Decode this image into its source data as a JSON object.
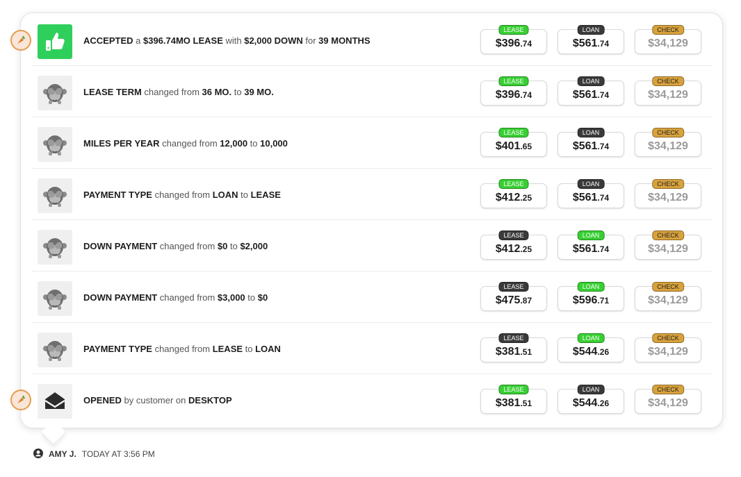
{
  "rows": [
    {
      "parts": [
        [
          "b",
          "ACCEPTED"
        ],
        [
          "t",
          " a "
        ],
        [
          "b",
          "$396.74MO LEASE"
        ],
        [
          "t",
          " with "
        ],
        [
          "b",
          "$2,000 DOWN"
        ],
        [
          "t",
          " for "
        ],
        [
          "b",
          "39 MONTHS"
        ]
      ],
      "icon": "thumbs-up-icon",
      "lease": {
        "tag": "LEASE",
        "dollars": "$396",
        "cents": ".74",
        "tag_style": "green"
      },
      "loan": {
        "tag": "LOAN",
        "dollars": "$561",
        "cents": ".74",
        "tag_style": "dark"
      },
      "check": {
        "tag": "CHECK",
        "value": "$34,129"
      }
    },
    {
      "parts": [
        [
          "b",
          "LEASE TERM"
        ],
        [
          "t",
          " changed from "
        ],
        [
          "b",
          "36 MO."
        ],
        [
          "t",
          " to "
        ],
        [
          "b",
          "39 MO."
        ]
      ],
      "icon": "see-no-evil-monkey-icon",
      "lease": {
        "tag": "LEASE",
        "dollars": "$396",
        "cents": ".74",
        "tag_style": "green"
      },
      "loan": {
        "tag": "LOAN",
        "dollars": "$561",
        "cents": ".74",
        "tag_style": "dark"
      },
      "check": {
        "tag": "CHECK",
        "value": "$34,129"
      }
    },
    {
      "parts": [
        [
          "b",
          "MILES PER YEAR"
        ],
        [
          "t",
          " changed from "
        ],
        [
          "b",
          "12,000"
        ],
        [
          "t",
          " to "
        ],
        [
          "b",
          "10,000"
        ]
      ],
      "icon": "see-no-evil-monkey-icon",
      "lease": {
        "tag": "LEASE",
        "dollars": "$401",
        "cents": ".65",
        "tag_style": "green"
      },
      "loan": {
        "tag": "LOAN",
        "dollars": "$561",
        "cents": ".74",
        "tag_style": "dark"
      },
      "check": {
        "tag": "CHECK",
        "value": "$34,129"
      }
    },
    {
      "parts": [
        [
          "b",
          "PAYMENT TYPE"
        ],
        [
          "t",
          " changed from "
        ],
        [
          "b",
          "LOAN"
        ],
        [
          "t",
          " to "
        ],
        [
          "b",
          "LEASE"
        ]
      ],
      "icon": "see-no-evil-monkey-icon",
      "lease": {
        "tag": "LEASE",
        "dollars": "$412",
        "cents": ".25",
        "tag_style": "green"
      },
      "loan": {
        "tag": "LOAN",
        "dollars": "$561",
        "cents": ".74",
        "tag_style": "dark"
      },
      "check": {
        "tag": "CHECK",
        "value": "$34,129"
      }
    },
    {
      "parts": [
        [
          "b",
          "DOWN PAYMENT"
        ],
        [
          "t",
          " changed from "
        ],
        [
          "b",
          "$0"
        ],
        [
          "t",
          " to "
        ],
        [
          "b",
          "$2,000"
        ]
      ],
      "icon": "see-no-evil-monkey-icon",
      "lease": {
        "tag": "LEASE",
        "dollars": "$412",
        "cents": ".25",
        "tag_style": "dark"
      },
      "loan": {
        "tag": "LOAN",
        "dollars": "$561",
        "cents": ".74",
        "tag_style": "green"
      },
      "check": {
        "tag": "CHECK",
        "value": "$34,129"
      }
    },
    {
      "parts": [
        [
          "b",
          "DOWN PAYMENT"
        ],
        [
          "t",
          " changed from "
        ],
        [
          "b",
          "$3,000"
        ],
        [
          "t",
          " to "
        ],
        [
          "b",
          "$0"
        ]
      ],
      "icon": "see-no-evil-monkey-icon",
      "lease": {
        "tag": "LEASE",
        "dollars": "$475",
        "cents": ".87",
        "tag_style": "dark"
      },
      "loan": {
        "tag": "LOAN",
        "dollars": "$596",
        "cents": ".71",
        "tag_style": "green"
      },
      "check": {
        "tag": "CHECK",
        "value": "$34,129"
      }
    },
    {
      "parts": [
        [
          "b",
          "PAYMENT TYPE"
        ],
        [
          "t",
          " changed from "
        ],
        [
          "b",
          "LEASE"
        ],
        [
          "t",
          " to "
        ],
        [
          "b",
          "LOAN"
        ]
      ],
      "icon": "see-no-evil-monkey-icon",
      "lease": {
        "tag": "LEASE",
        "dollars": "$381",
        "cents": ".51",
        "tag_style": "dark"
      },
      "loan": {
        "tag": "LOAN",
        "dollars": "$544",
        "cents": ".26",
        "tag_style": "green"
      },
      "check": {
        "tag": "CHECK",
        "value": "$34,129"
      }
    },
    {
      "parts": [
        [
          "b",
          "OPENED"
        ],
        [
          "t",
          " by customer on "
        ],
        [
          "b",
          "DESKTOP"
        ]
      ],
      "icon": "envelope-open-icon",
      "lease": {
        "tag": "LEASE",
        "dollars": "$381",
        "cents": ".51",
        "tag_style": "green"
      },
      "loan": {
        "tag": "LOAN",
        "dollars": "$544",
        "cents": ".26",
        "tag_style": "dark"
      },
      "check": {
        "tag": "CHECK",
        "value": "$34,129"
      }
    }
  ],
  "side_badges": [
    {
      "row": 0,
      "icon": "carrot-icon"
    },
    {
      "row": 7,
      "icon": "carrot-icon"
    }
  ],
  "footer": {
    "name": "AMY J.",
    "time": "TODAY AT 3:56 PM",
    "icon": "user-circle-icon"
  },
  "colors": {
    "green": "#38cf33",
    "dark": "#3a3a3a",
    "gold": "#d8a23c",
    "badge": "#e89a4f"
  }
}
